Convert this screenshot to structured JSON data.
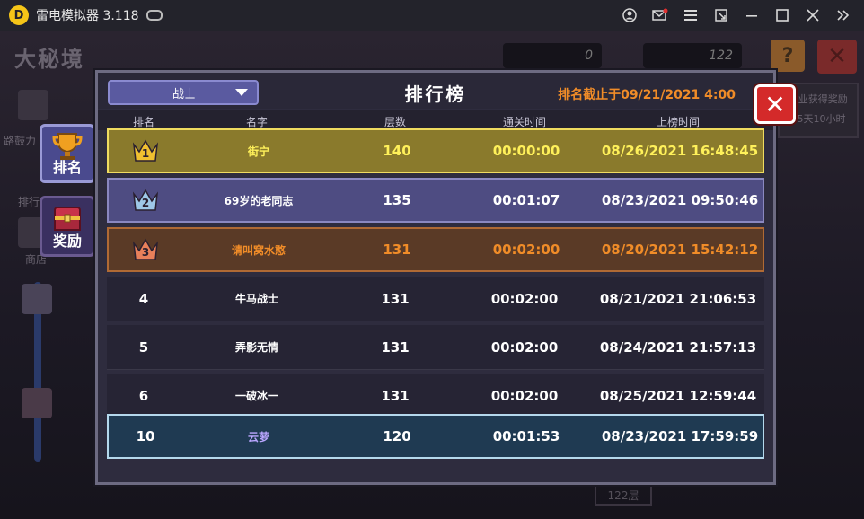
{
  "window": {
    "title": "雷电模拟器 3.118",
    "icons": [
      "gamepad-icon",
      "account-icon",
      "mail-icon",
      "menu-icon",
      "popout-icon",
      "minimize-icon",
      "maximize-icon",
      "close-icon",
      "collapse-sidebar-icon"
    ]
  },
  "background": {
    "title": "大秘境",
    "res1": "0",
    "res2": "122",
    "reward_line1": "...业获得奖励",
    "reward_line2": "25天10小时",
    "side_labels": [
      "路鼓力",
      "排行",
      "商店"
    ],
    "floor_label": "122层"
  },
  "sidebar_tabs": [
    {
      "label": "排名",
      "active": true
    },
    {
      "label": "奖励",
      "active": false
    }
  ],
  "panel": {
    "class_select": "战士",
    "title": "排行榜",
    "deadline": "排名截止于09/21/2021 4:00",
    "columns": [
      "排名",
      "名字",
      "层数",
      "通关时间",
      "上榜时间"
    ],
    "rows": [
      {
        "rank": "1",
        "name": "街宁",
        "floor": "140",
        "time": "00:00:00",
        "date": "08/26/2021 16:48:45",
        "style": "gold"
      },
      {
        "rank": "2",
        "name": "69岁的老同志",
        "floor": "135",
        "time": "00:01:07",
        "date": "08/23/2021 09:50:46",
        "style": "silver"
      },
      {
        "rank": "3",
        "name": "请叫窝水憨",
        "floor": "131",
        "time": "00:02:00",
        "date": "08/20/2021 15:42:12",
        "style": "bronze"
      },
      {
        "rank": "4",
        "name": "牛马战士",
        "floor": "131",
        "time": "00:02:00",
        "date": "08/21/2021 21:06:53",
        "style": "normal"
      },
      {
        "rank": "5",
        "name": "弄影无情",
        "floor": "131",
        "time": "00:02:00",
        "date": "08/24/2021 21:57:13",
        "style": "normal"
      },
      {
        "rank": "6",
        "name": "一破冰一",
        "floor": "131",
        "time": "00:02:00",
        "date": "08/25/2021 12:59:44",
        "style": "normal"
      },
      {
        "rank": "10",
        "name": "云萝",
        "floor": "120",
        "time": "00:01:53",
        "date": "08/23/2021 17:59:59",
        "style": "self"
      }
    ]
  },
  "colors": {
    "gold_bg": "#8a7a2c",
    "gold_text": "#fff15a",
    "gold_border": "#f0dc60",
    "silver_bg": "#4e4c82",
    "silver_text": "#ffffff",
    "silver_border": "#8a88c0",
    "bronze_bg": "#5a3a26",
    "bronze_text": "#f08c28",
    "bronze_border": "#b06a34",
    "normal_bg": "#262434",
    "normal_text": "#ffffff",
    "self_bg": "#1f3a52",
    "self_text": "#ffffff",
    "self_border": "#b4d8ec",
    "self_name": "#b9a6ff",
    "accent": "#f08c28"
  }
}
